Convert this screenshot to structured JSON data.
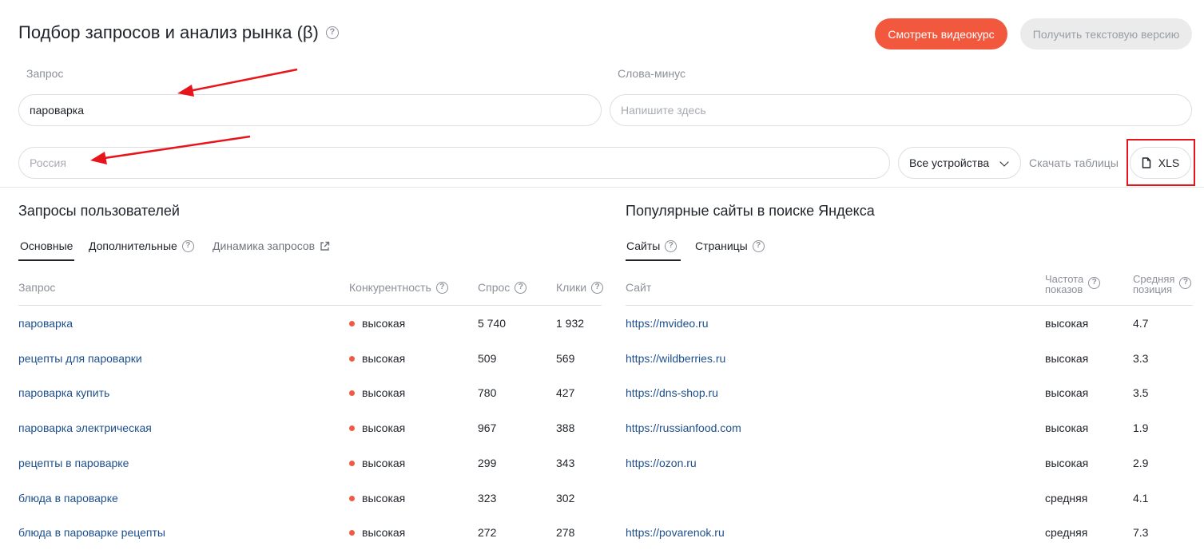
{
  "header": {
    "title": "Подбор запросов и анализ рынка (β)",
    "video_button": "Смотреть видеокурс",
    "text_version_button": "Получить текстовую версию"
  },
  "form": {
    "query_label": "Запрос",
    "query_value": "пароварка",
    "minus_label": "Слова-минус",
    "minus_placeholder": "Напишите здесь",
    "region_placeholder": "Россия",
    "devices_value": "Все устройства",
    "download_label": "Скачать таблицы",
    "xls_label": "XLS"
  },
  "left": {
    "title": "Запросы пользователей",
    "tabs": [
      "Основные",
      "Дополнительные",
      "Динамика запросов"
    ],
    "columns": [
      "Запрос",
      "Конкурентность",
      "Спрос",
      "Клики"
    ],
    "rows": [
      {
        "query": "пароварка",
        "competition": "высокая",
        "demand": "5 740",
        "clicks": "1 932"
      },
      {
        "query": "рецепты для пароварки",
        "competition": "высокая",
        "demand": "509",
        "clicks": "569"
      },
      {
        "query": "пароварка купить",
        "competition": "высокая",
        "demand": "780",
        "clicks": "427"
      },
      {
        "query": "пароварка электрическая",
        "competition": "высокая",
        "demand": "967",
        "clicks": "388"
      },
      {
        "query": "рецепты в пароварке",
        "competition": "высокая",
        "demand": "299",
        "clicks": "343"
      },
      {
        "query": "блюда в пароварке",
        "competition": "высокая",
        "demand": "323",
        "clicks": "302"
      },
      {
        "query": "блюда в пароварке рецепты",
        "competition": "высокая",
        "demand": "272",
        "clicks": "278"
      }
    ]
  },
  "right": {
    "title": "Популярные сайты в поиске Яндекса",
    "tabs": [
      "Сайты",
      "Страницы"
    ],
    "columns": {
      "site": "Сайт",
      "freq_line1": "Частота",
      "freq_line2": "показов",
      "pos_line1": "Средняя",
      "pos_line2": "позиция"
    },
    "rows": [
      {
        "site": "https://mvideo.ru",
        "freq": "высокая",
        "pos": "4.7"
      },
      {
        "site": "https://wildberries.ru",
        "freq": "высокая",
        "pos": "3.3"
      },
      {
        "site": "https://dns-shop.ru",
        "freq": "высокая",
        "pos": "3.5"
      },
      {
        "site": "https://russianfood.com",
        "freq": "высокая",
        "pos": "1.9"
      },
      {
        "site": "https://ozon.ru",
        "freq": "высокая",
        "pos": "2.9"
      },
      {
        "site": "",
        "freq": "средняя",
        "pos": "4.1"
      },
      {
        "site": "https://povarenok.ru",
        "freq": "средняя",
        "pos": "7.3"
      }
    ]
  },
  "icons": {
    "help": "question-circle-icon",
    "external": "external-link-icon",
    "file": "file-icon",
    "chevron": "chevron-down-icon",
    "annotation_arrow": "red-arrow-annotation"
  },
  "colors": {
    "accent": "#f2583d",
    "link": "#1e4f8c",
    "dot": "#ef5a45",
    "highlight": "#e8141b"
  }
}
